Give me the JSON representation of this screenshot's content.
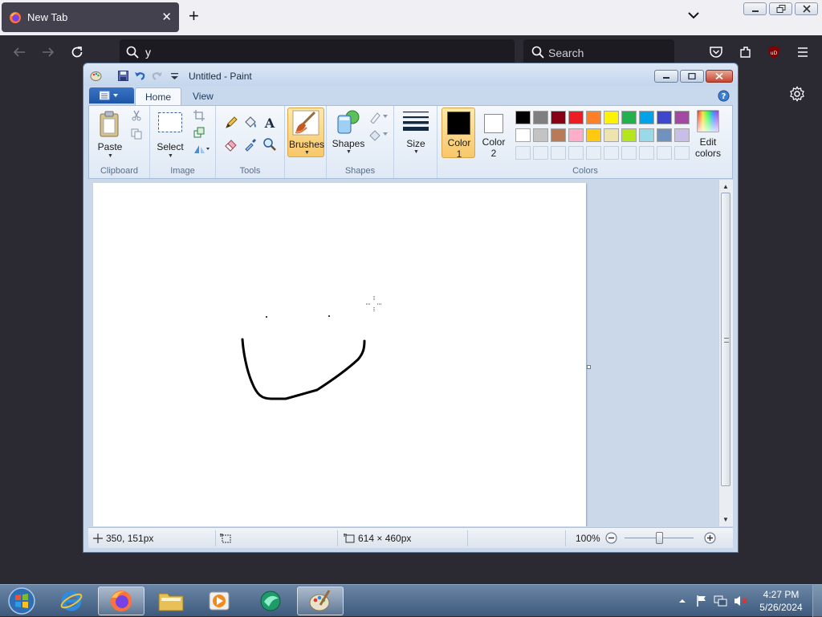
{
  "browser": {
    "tab_title": "New Tab",
    "url_value": "y",
    "search_placeholder": "Search"
  },
  "paint": {
    "window_title": "Untitled - Paint",
    "tabs": [
      "Home",
      "View"
    ],
    "groups": {
      "clipboard": "Clipboard",
      "image": "Image",
      "tools": "Tools",
      "shapes": "Shapes",
      "colors": "Colors"
    },
    "buttons": {
      "paste": "Paste",
      "select": "Select",
      "brushes": "Brushes",
      "shapes": "Shapes",
      "size": "Size",
      "color1_line1": "Color",
      "color1_line2": "1",
      "color2_line1": "Color",
      "color2_line2": "2",
      "edit_colors_line1": "Edit",
      "edit_colors_line2": "colors"
    },
    "color1": "#000000",
    "color2": "#ffffff",
    "palette_row1": [
      "#000000",
      "#7f7f7f",
      "#880015",
      "#ed1c24",
      "#ff7f27",
      "#fff200",
      "#22b14c",
      "#00a2e8",
      "#3f48cc",
      "#a349a4"
    ],
    "palette_row2": [
      "#ffffff",
      "#c3c3c3",
      "#b97a57",
      "#ffaec9",
      "#ffc90e",
      "#efe4b0",
      "#b5e61d",
      "#99d9ea",
      "#7092be",
      "#c8bfe7"
    ],
    "status": {
      "cursor_pos": "350, 151px",
      "canvas_size": "614 × 460px",
      "zoom": "100%"
    },
    "zoom_fraction": 0.5
  },
  "taskbar": {
    "time": "4:27 PM",
    "date": "5/26/2024"
  }
}
